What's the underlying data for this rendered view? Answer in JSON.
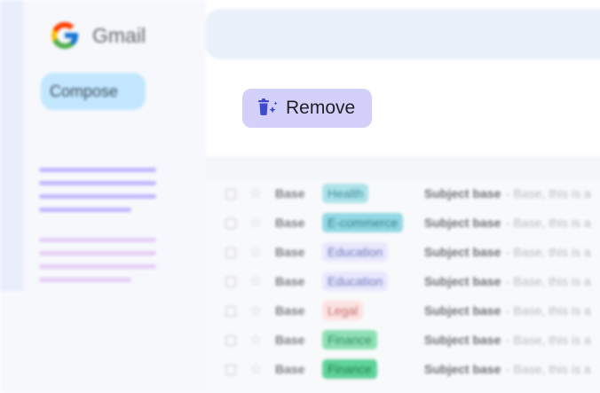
{
  "app": {
    "title": "Gmail"
  },
  "sidebar": {
    "compose_label": "Compose"
  },
  "toolbar": {
    "remove_label": "Remove"
  },
  "colors": {
    "remove_bg": "#d3d0fb",
    "compose_bg": "#c2e7ff",
    "primary": "#3c4ad0"
  },
  "emails": [
    {
      "sender": "Base",
      "tag": "Health",
      "tag_bg": "#aee3ea",
      "tag_fg": "#3a8a96",
      "subject": "Subject base",
      "snippet": " - Base, this is a"
    },
    {
      "sender": "Base",
      "tag": "E-commerce",
      "tag_bg": "#93d8e4",
      "tag_fg": "#2e7e8c",
      "subject": "Subject base",
      "snippet": " - Base, this is a"
    },
    {
      "sender": "Base",
      "tag": "Education",
      "tag_bg": "#e7e8fd",
      "tag_fg": "#6f74b8",
      "subject": "Subject base",
      "snippet": " - Base, this is a"
    },
    {
      "sender": "Base",
      "tag": "Education",
      "tag_bg": "#e7e8fd",
      "tag_fg": "#6f74b8",
      "subject": "Subject base",
      "snippet": " - Base, this is a"
    },
    {
      "sender": "Base",
      "tag": "Legal",
      "tag_bg": "#fde2e2",
      "tag_fg": "#c26d6d",
      "subject": "Subject base",
      "snippet": " - Base, this is a"
    },
    {
      "sender": "Base",
      "tag": "Finance",
      "tag_bg": "#8ee0b4",
      "tag_fg": "#2e8a5a",
      "subject": "Subject base",
      "snippet": " - Base, this is a"
    },
    {
      "sender": "Base",
      "tag": "Finance",
      "tag_bg": "#5fd39a",
      "tag_fg": "#1f7a4a",
      "subject": "Subject base",
      "snippet": " - Base, this is a"
    }
  ]
}
